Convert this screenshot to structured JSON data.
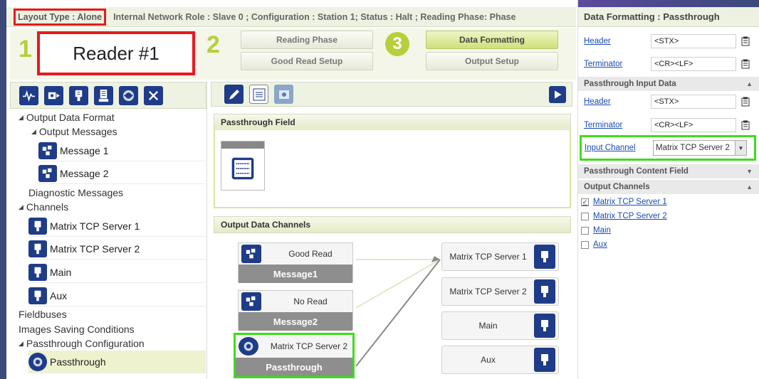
{
  "status_bar": {
    "layout_type": "Layout Type : Alone",
    "rest": "Internal Network Role : Slave 0 ; Configuration : Station 1; Status : Halt ; Reading Phase: Phase"
  },
  "steps": {
    "step1_num": "1",
    "reader_label": "Reader #1",
    "step2_num": "2",
    "step3_num": "3",
    "reading_phase": "Reading Phase",
    "good_read_setup": "Good Read Setup",
    "data_formatting": "Data Formatting",
    "output_setup": "Output Setup"
  },
  "tree": {
    "output_data_format": "Output Data Format",
    "output_messages": "Output Messages",
    "message1": "Message 1",
    "message2": "Message 2",
    "diagnostic_messages": "Diagnostic Messages",
    "channels": "Channels",
    "matrix_tcp1": "Matrix TCP Server 1",
    "matrix_tcp2": "Matrix TCP Server 2",
    "main": "Main",
    "aux": "Aux",
    "fieldbuses": "Fieldbuses",
    "images_saving": "Images Saving Conditions",
    "passthrough_config": "Passthrough Configuration",
    "passthrough": "Passthrough"
  },
  "center": {
    "passthrough_field": "Passthrough Field",
    "output_data_channels": "Output Data Channels",
    "node1_top": "Good Read",
    "node1_bottom": "Message1",
    "node2_top": "No Read",
    "node2_bottom": "Message2",
    "node3_top": "Matrix TCP Server 2",
    "node3_bottom": "Passthrough",
    "out1": "Matrix TCP Server 1",
    "out2": "Matrix TCP Server 2",
    "out3": "Main",
    "out4": "Aux"
  },
  "right": {
    "title": "Data Formatting : Passthrough",
    "header_label": "Header",
    "header_value": "<STX>",
    "terminator_label": "Terminator",
    "terminator_value": "<CR><LF>",
    "passthrough_input_data": "Passthrough Input Data",
    "header2_label": "Header",
    "header2_value": "<STX>",
    "terminator2_label": "Terminator",
    "terminator2_value": "<CR><LF>",
    "input_channel_label": "Input Channel",
    "input_channel_value": "Matrix TCP Server 2",
    "passthrough_content_field": "Passthrough Content Field",
    "output_channels": "Output Channels",
    "oc1": "Matrix TCP Server 1",
    "oc1_checked": true,
    "oc2": "Matrix TCP Server 2",
    "oc2_checked": false,
    "oc3": "Main",
    "oc3_checked": false,
    "oc4": "Aux",
    "oc4_checked": false
  },
  "colors": {
    "accent_green": "#b6cf3b",
    "highlight_red": "#e8191f",
    "highlight_green": "#3fdc1b",
    "icon_blue": "#1f3c88"
  }
}
